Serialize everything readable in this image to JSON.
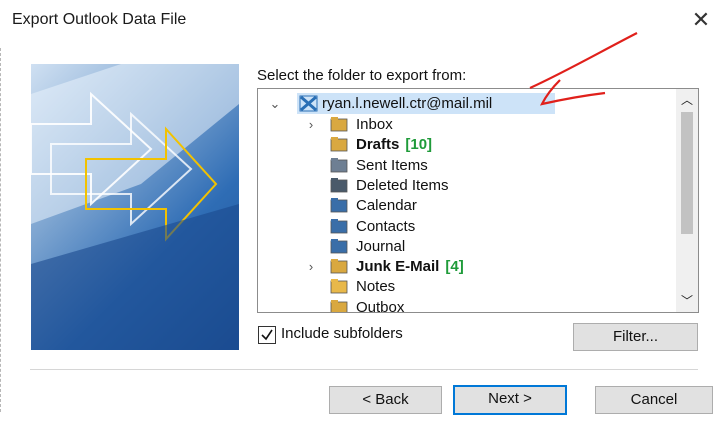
{
  "window": {
    "title": "Export Outlook Data File",
    "close_glyph": "✕"
  },
  "prompt": "Select the folder to export from:",
  "account": {
    "email": "ryan.l.newell.ctr@mail.mil"
  },
  "folders": [
    {
      "label": "Inbox",
      "count": "",
      "bold": false,
      "icon": "inbox-icon"
    },
    {
      "label": "Drafts",
      "count": "[10]",
      "bold": true,
      "icon": "drafts-icon"
    },
    {
      "label": "Sent Items",
      "count": "",
      "bold": false,
      "icon": "sent-icon"
    },
    {
      "label": "Deleted Items",
      "count": "",
      "bold": false,
      "icon": "trash-icon"
    },
    {
      "label": "Calendar",
      "count": "",
      "bold": false,
      "icon": "calendar-icon"
    },
    {
      "label": "Contacts",
      "count": "",
      "bold": false,
      "icon": "contacts-icon"
    },
    {
      "label": "Journal",
      "count": "",
      "bold": false,
      "icon": "journal-icon"
    },
    {
      "label": "Junk E-Mail",
      "count": "[4]",
      "bold": true,
      "icon": "junk-icon"
    },
    {
      "label": "Notes",
      "count": "",
      "bold": false,
      "icon": "notes-icon"
    },
    {
      "label": "Outbox",
      "count": "",
      "bold": false,
      "icon": "outbox-icon"
    }
  ],
  "include_subfolders": {
    "label": "Include subfolders",
    "checked": true
  },
  "buttons": {
    "filter": "Filter...",
    "back": "< Back",
    "next": "Next >",
    "cancel": "Cancel"
  },
  "colors": {
    "count_green": "#1f9b3a",
    "selection": "#cde3f8",
    "annotation_red": "#e0201b",
    "primary_border": "#0078d7"
  }
}
